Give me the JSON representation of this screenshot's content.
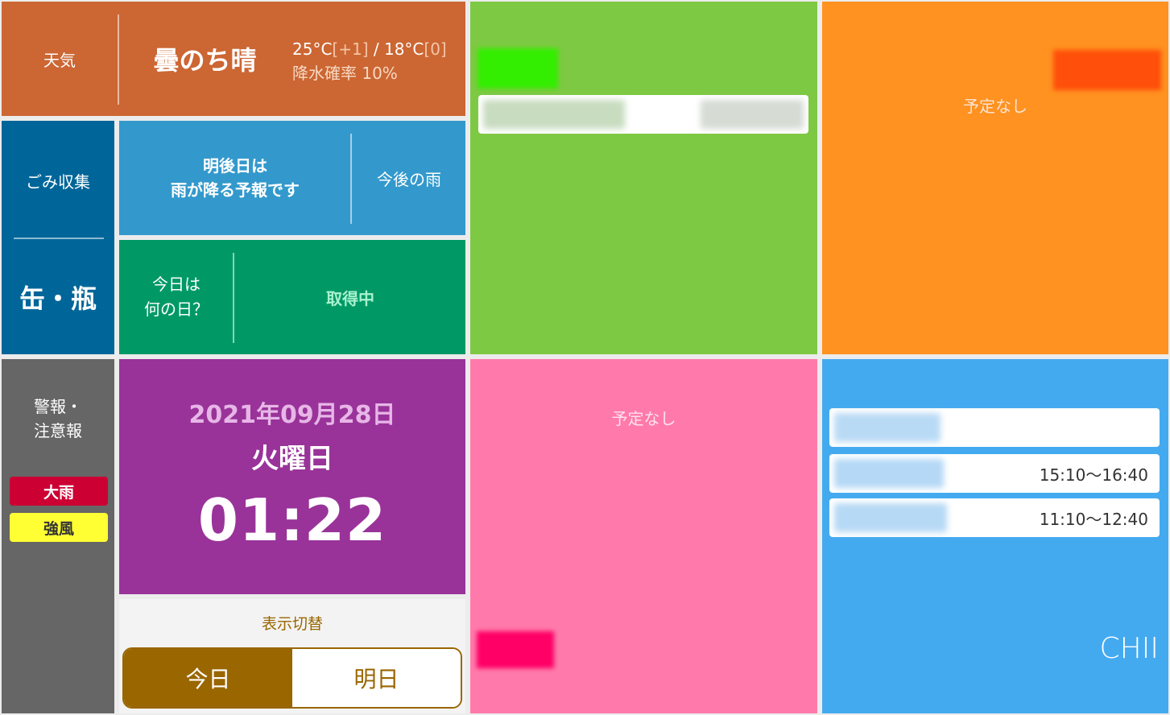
{
  "weather": {
    "label": "天気",
    "condition": "曇のち晴",
    "high_temp": "25°C",
    "high_diff": "[+1]",
    "separator": " / ",
    "low_temp": "18°C",
    "low_diff": "[0]",
    "rain_probability": "降水確率 10%"
  },
  "garbage": {
    "label": "ごみ収集",
    "type": "缶・瓶"
  },
  "rain_forecast": {
    "message_line1": "明後日は",
    "message_line2": "雨が降る予報です",
    "button_label": "今後の雨"
  },
  "what_day": {
    "label_line1": "今日は",
    "label_line2": "何の日？",
    "status": "取得中"
  },
  "alerts": {
    "label_line1": "警報・",
    "label_line2": "注意報",
    "items": [
      {
        "label": "大雨",
        "color": "#cc0033"
      },
      {
        "label": "強風",
        "color": "#ffff33"
      }
    ]
  },
  "clock": {
    "date": "2021年09月28日",
    "day_of_week": "火曜日",
    "time": "01:22"
  },
  "display_toggle": {
    "label": "表示切替",
    "options": [
      "今日",
      "明日"
    ],
    "selected": "今日"
  },
  "calendars": {
    "orange": {
      "no_events": "予定なし"
    },
    "pink": {
      "no_events": "予定なし"
    },
    "blue": {
      "owner": "CHII",
      "events": [
        {
          "time": ""
        },
        {
          "time": "15:10〜16:40"
        },
        {
          "time": "11:10〜12:40"
        }
      ]
    }
  },
  "colors": {
    "weather": "#cc6633",
    "garbage": "#006699",
    "rain": "#3399cc",
    "what_day": "#009966",
    "alerts": "#666666",
    "clock": "#993399",
    "toggle_accent": "#996600",
    "calendar_green": "#7ec943",
    "calendar_orange": "#ff9220",
    "calendar_pink": "#ff7aaa",
    "calendar_blue": "#44aaf0"
  }
}
